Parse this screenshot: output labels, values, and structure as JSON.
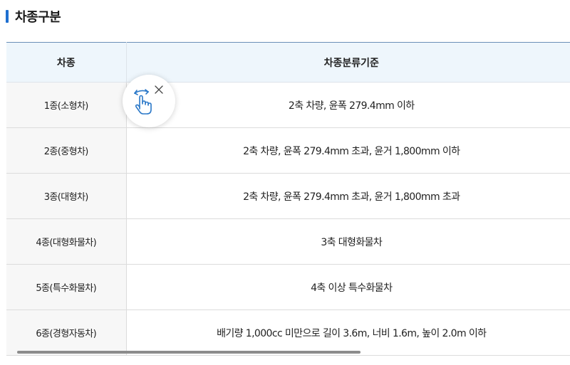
{
  "section": {
    "title": "차종구분"
  },
  "table": {
    "headers": [
      "차종",
      "차종분류기준"
    ],
    "rows": [
      {
        "type": "1종(소형차)",
        "criteria": "2축 차량, 윤폭 279.4mm 이하"
      },
      {
        "type": "2종(중형차)",
        "criteria": "2축 차량, 윤폭 279.4mm 초과, 윤거 1,800mm 이하"
      },
      {
        "type": "3종(대형차)",
        "criteria": "2축 차량, 윤폭 279.4mm 초과, 윤거 1,800mm 초과"
      },
      {
        "type": "4종(대형화물차)",
        "criteria": "3축 대형화물차"
      },
      {
        "type": "5종(특수화물차)",
        "criteria": "4축 이상 특수화물차"
      },
      {
        "type": "6종(경형자동차)",
        "criteria": "배기량 1,000cc 미만으로 길이 3.6m, 너비 1.6m, 높이 2.0m 이하"
      }
    ]
  },
  "swipe_hint": {
    "icon": "swipe-hand-icon",
    "close_icon": "close-icon"
  },
  "colors": {
    "accent": "#1e6fd0",
    "header_bg": "#eef6fc",
    "type_cell_bg": "#f7f7f7",
    "hint_icon": "#2a78c8"
  }
}
